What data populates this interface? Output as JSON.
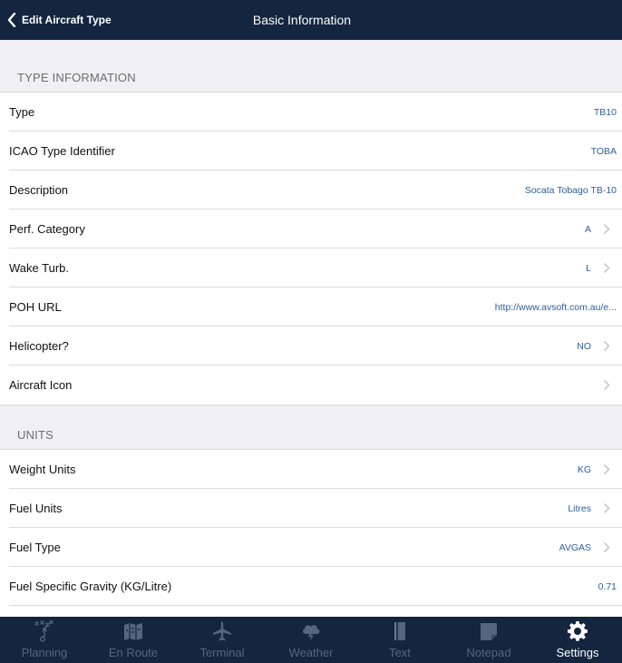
{
  "navbar": {
    "back_label": "Edit Aircraft Type",
    "title": "Basic Information"
  },
  "sections": {
    "type_information": {
      "header": "TYPE INFORMATION",
      "rows": [
        {
          "label": "Type",
          "value": "TB10"
        },
        {
          "label": "ICAO Type Identifier",
          "value": "TOBA"
        },
        {
          "label": "Description",
          "value": "Socata Tobago TB-10"
        },
        {
          "label": "Perf. Category",
          "value": "A"
        },
        {
          "label": "Wake Turb.",
          "value": "L"
        },
        {
          "label": "POH URL",
          "value": "http://www.avsoft.com.au/e..."
        },
        {
          "label": "Helicopter?",
          "value": "NO"
        },
        {
          "label": "Aircraft Icon",
          "value": ""
        }
      ]
    },
    "units": {
      "header": "UNITS",
      "rows": [
        {
          "label": "Weight Units",
          "value": "KG"
        },
        {
          "label": "Fuel Units",
          "value": "Litres"
        },
        {
          "label": "Fuel Type",
          "value": "AVGAS"
        },
        {
          "label": "Fuel Specific Gravity (KG/Litre)",
          "value": "0.71"
        }
      ]
    }
  },
  "tabbar": {
    "tabs": [
      {
        "label": "Planning",
        "icon": "planning-icon"
      },
      {
        "label": "En Route",
        "icon": "map-icon"
      },
      {
        "label": "Terminal",
        "icon": "airplane-icon"
      },
      {
        "label": "Weather",
        "icon": "weather-icon"
      },
      {
        "label": "Text",
        "icon": "document-icon"
      },
      {
        "label": "Notepad",
        "icon": "notepad-icon"
      },
      {
        "label": "Settings",
        "icon": "gear-icon"
      }
    ],
    "active": "Settings"
  },
  "colors": {
    "navbar_bg": "#13253f",
    "value_blue": "#2f5f9b",
    "page_bg": "#efeff4",
    "tab_inactive": "#55657f",
    "tab_active": "#ffffff"
  }
}
